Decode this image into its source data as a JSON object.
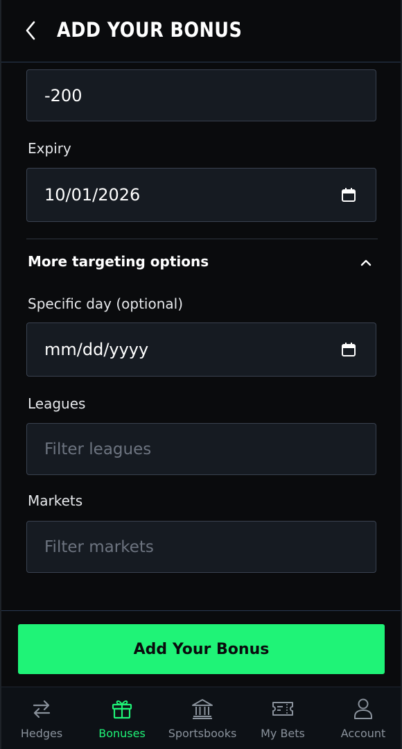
{
  "header": {
    "title": "ADD YOUR BONUS"
  },
  "form": {
    "odds_value": "-200",
    "expiry": {
      "label": "Expiry",
      "value": "10/01/2026"
    },
    "targeting": {
      "title": "More targeting options",
      "expanded": true
    },
    "specific_day": {
      "label": "Specific day (optional)",
      "placeholder": "mm/dd/yyyy"
    },
    "leagues": {
      "label": "Leagues",
      "placeholder": "Filter leagues"
    },
    "markets": {
      "label": "Markets",
      "placeholder": "Filter markets"
    }
  },
  "actions": {
    "submit_label": "Add Your Bonus"
  },
  "tabbar": {
    "items": [
      {
        "label": "Hedges",
        "icon": "arrows-swap-icon",
        "active": false
      },
      {
        "label": "Bonuses",
        "icon": "gift-icon",
        "active": true
      },
      {
        "label": "Sportsbooks",
        "icon": "bank-icon",
        "active": false
      },
      {
        "label": "My Bets",
        "icon": "ticket-icon",
        "active": false
      },
      {
        "label": "Account",
        "icon": "user-icon",
        "active": false
      }
    ]
  },
  "colors": {
    "accent": "#1ff377",
    "background": "#0a0b0d",
    "field_bg": "#161b22",
    "field_border": "#3a4250",
    "muted_text": "#8a929c"
  }
}
